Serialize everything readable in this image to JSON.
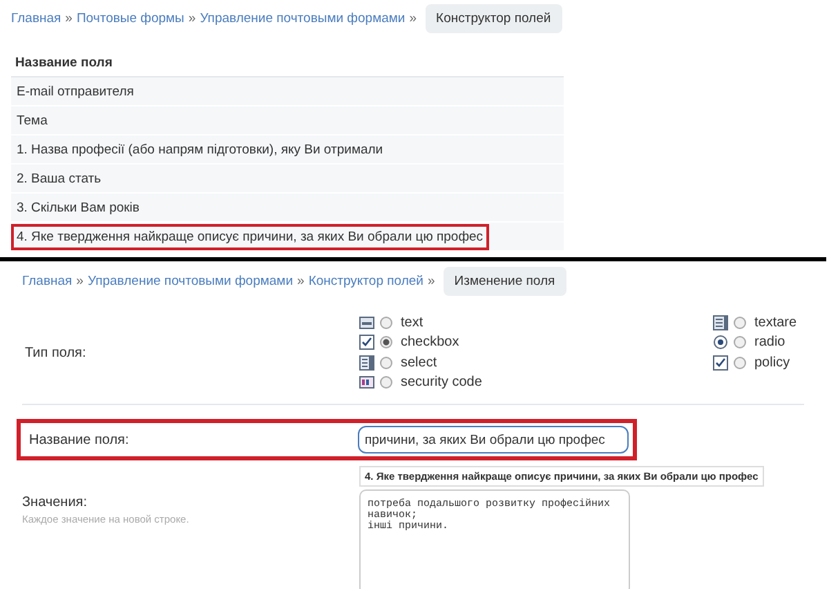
{
  "top_breadcrumb": {
    "links": [
      {
        "label": "Главная",
        "separator": "»"
      },
      {
        "label": "Почтовые формы",
        "separator": "»"
      },
      {
        "label": "Управление почтовыми формами",
        "separator": "»"
      }
    ],
    "current": "Конструктор полей"
  },
  "fields_table": {
    "header": "Название поля",
    "rows": [
      {
        "name": "E-mail отправителя",
        "highlighted": false
      },
      {
        "name": "Тема",
        "highlighted": false
      },
      {
        "name": "1. Назва професії (або напрям підготовки), яку Ви отримали",
        "highlighted": false
      },
      {
        "name": "2. Ваша стать",
        "highlighted": false
      },
      {
        "name": "3. Скільки Вам років",
        "highlighted": false
      },
      {
        "name": "4. Яке твердження найкраще описує причини, за яких Ви обрали цю профес",
        "highlighted": true
      }
    ]
  },
  "edit_breadcrumb": {
    "links": [
      {
        "label": "Главная",
        "separator": "»"
      },
      {
        "label": "Управление почтовыми формами",
        "separator": "»"
      },
      {
        "label": "Конструктор полей",
        "separator": "»"
      }
    ],
    "current": "Изменение поля"
  },
  "field_type": {
    "label": "Тип поля:",
    "option_columns": [
      [
        {
          "label": "text",
          "selected": false,
          "kind": "text"
        },
        {
          "label": "checkbox",
          "selected": true,
          "kind": "check"
        },
        {
          "label": "select",
          "selected": false,
          "kind": "list"
        },
        {
          "label": "security code",
          "selected": false,
          "kind": "code"
        }
      ],
      [
        {
          "label": "textare",
          "selected": false,
          "kind": "area"
        },
        {
          "label": "radio",
          "selected": false,
          "kind": "radio"
        },
        {
          "label": "policy",
          "selected": false,
          "kind": "check"
        }
      ]
    ]
  },
  "field_name": {
    "label": "Название поля:",
    "value": "причини, за яких Ви обрали цю профес",
    "highlighted": true,
    "tooltip": "4. Яке твердження найкраще описує причини, за яких Ви обрали цю профес"
  },
  "values": {
    "label": "Значения:",
    "hint": "Каждое значение на новой строке.",
    "value": "потреба подальшого розвитку професійних навичок;\nінші причини."
  }
}
